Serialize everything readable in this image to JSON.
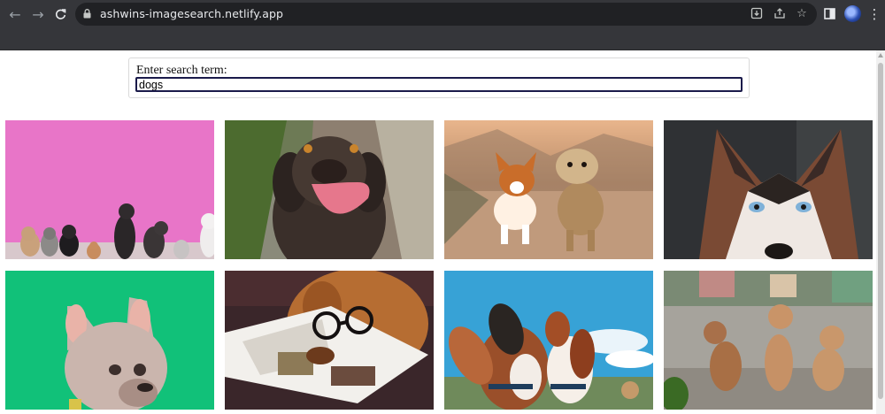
{
  "browser": {
    "url": "ashwins-imagesearch.netlify.app",
    "icons": [
      "back-icon",
      "forward-icon",
      "reload-icon",
      "lock-icon",
      "download-icon",
      "share-icon",
      "bookmark-star-icon",
      "sidebar-icon",
      "profile-avatar",
      "more-menu-icon"
    ]
  },
  "search": {
    "label": "Enter search term:",
    "value": "dogs"
  },
  "results": [
    {
      "subject": "group of dogs against pink wall"
    },
    {
      "subject": "brown labrador licking nose"
    },
    {
      "subject": "corgi and yorkshire terrier running"
    },
    {
      "subject": "husky close-up"
    },
    {
      "subject": "french bulldog on green background"
    },
    {
      "subject": "dog with glasses reading magazine"
    },
    {
      "subject": "two dogs looking up under blue sky"
    },
    {
      "subject": "three puppies sitting on gravel"
    }
  ],
  "colors": {
    "chrome": "#35363a",
    "omnibox": "#202124",
    "input_border": "#1a1a4a"
  }
}
